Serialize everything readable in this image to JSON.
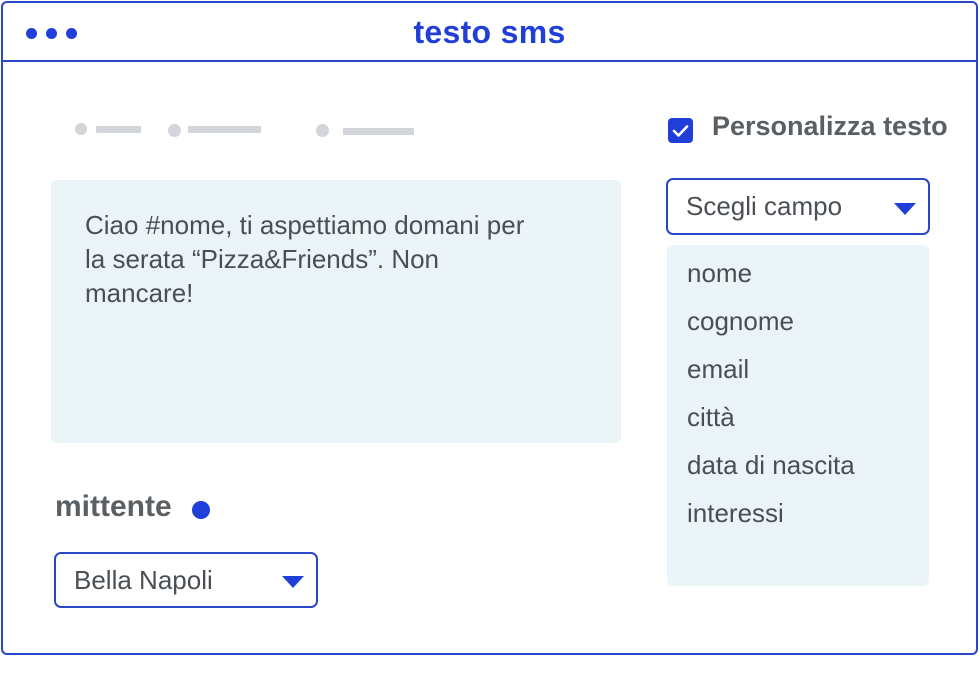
{
  "window": {
    "title": "testo sms"
  },
  "message": {
    "text": "Ciao #nome, ti aspettiamo domani per la serata “Pizza&Friends”. Non mancare!"
  },
  "sender": {
    "label": "mittente",
    "selected": "Bella Napoli"
  },
  "personalize": {
    "label": "Personalizza testo",
    "checked": true
  },
  "field_select": {
    "selected": "Scegli campo",
    "options": [
      "nome",
      "cognome",
      "email",
      "città",
      "data di nascita",
      "interessi"
    ]
  },
  "colors": {
    "accent": "#1f3fd8",
    "panel": "#ebf4f7",
    "text": "#4a4f54"
  },
  "icons": {
    "caret": "chevron-down-icon",
    "check": "check-icon"
  }
}
